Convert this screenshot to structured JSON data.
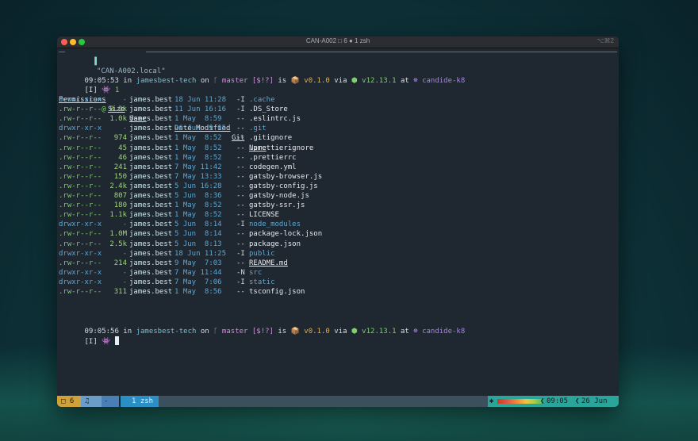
{
  "window": {
    "title": "CAN-A002 □ 6 ● 1 zsh",
    "shortcut": "⌥⌘2"
  },
  "terminal": {
    "host_header": "\"CAN-A002.local\"",
    "host_icon": "▐",
    "prompts": [
      {
        "time": "09:05:53",
        "in": " in ",
        "dir": "jamesbest-tech",
        "on": " on ",
        "branch_icon": "ᚴ",
        "branch": " master",
        "status": " [$!?]",
        "is": " is ",
        "pkg_icon": "📦",
        "pkg": " v0.1.0",
        "via": " via ",
        "node_icon": "⬢",
        "node": " v12.13.1",
        "at": " at ",
        "kube_icon": "☸",
        "kube": " candide-k8"
      },
      {
        "time": "09:05:56",
        "in": " in ",
        "dir": "jamesbest-tech",
        "on": " on ",
        "branch_icon": "ᚴ",
        "branch": " master",
        "status": " [$!?]",
        "is": " is ",
        "pkg_icon": "📦",
        "pkg": " v0.1.0",
        "via": " via ",
        "node_icon": "⬢",
        "node": " v12.13.1",
        "at": " at ",
        "kube_icon": "☸",
        "kube": " candide-k8"
      }
    ],
    "mode1": "[I] ",
    "mode1_icon": "👾",
    "mode1_count": " 1",
    "mode2": "[I] ",
    "mode2_icon": "👾",
    "headers": {
      "permissions": "Permissions",
      "size": "Size",
      "user": "User",
      "date": "Date Modified",
      "git": "Git",
      "name": "Name"
    },
    "rows": [
      {
        "perm": "drwxr-xr-x",
        "size": "-",
        "user": "james.best",
        "date": "18 Jun 11:28",
        "git": "-I",
        "name": ".cache",
        "dir": true
      },
      {
        "perm": ".rw-r--r--@",
        "size": "8.2k",
        "user": "james.best",
        "date": "11 Jun 16:16",
        "git": "-I",
        "name": ".DS_Store",
        "dir": false
      },
      {
        "perm": ".rw-r--r--",
        "size": "1.0k",
        "user": "james.best",
        "date": "1 May  8:59",
        "git": "--",
        "name": ".eslintrc.js",
        "dir": false
      },
      {
        "perm": "drwxr-xr-x",
        "size": "-",
        "user": "james.best",
        "date": "26 Jun  9:05",
        "git": "--",
        "name": ".git",
        "dir": true
      },
      {
        "perm": ".rw-r--r--",
        "size": "974",
        "user": "james.best",
        "date": "1 May  8:52",
        "git": "--",
        "name": ".gitignore",
        "dir": false
      },
      {
        "perm": ".rw-r--r--",
        "size": "45",
        "user": "james.best",
        "date": "1 May  8:52",
        "git": "--",
        "name": ".prettierignore",
        "dir": false
      },
      {
        "perm": ".rw-r--r--",
        "size": "46",
        "user": "james.best",
        "date": "1 May  8:52",
        "git": "--",
        "name": ".prettierrc",
        "dir": false
      },
      {
        "perm": ".rw-r--r--",
        "size": "241",
        "user": "james.best",
        "date": "7 May 11:42",
        "git": "--",
        "name": "codegen.yml",
        "dir": false
      },
      {
        "perm": ".rw-r--r--",
        "size": "150",
        "user": "james.best",
        "date": "7 May 13:33",
        "git": "--",
        "name": "gatsby-browser.js",
        "dir": false
      },
      {
        "perm": ".rw-r--r--",
        "size": "2.4k",
        "user": "james.best",
        "date": "5 Jun 16:28",
        "git": "--",
        "name": "gatsby-config.js",
        "dir": false
      },
      {
        "perm": ".rw-r--r--",
        "size": "807",
        "user": "james.best",
        "date": "5 Jun  8:36",
        "git": "--",
        "name": "gatsby-node.js",
        "dir": false
      },
      {
        "perm": ".rw-r--r--",
        "size": "180",
        "user": "james.best",
        "date": "1 May  8:52",
        "git": "--",
        "name": "gatsby-ssr.js",
        "dir": false
      },
      {
        "perm": ".rw-r--r--",
        "size": "1.1k",
        "user": "james.best",
        "date": "1 May  8:52",
        "git": "--",
        "name": "LICENSE",
        "dir": false
      },
      {
        "perm": "drwxr-xr-x",
        "size": "-",
        "user": "james.best",
        "date": "5 Jun  8:14",
        "git": "-I",
        "name": "node_modules",
        "dir": true
      },
      {
        "perm": ".rw-r--r--",
        "size": "1.0M",
        "user": "james.best",
        "date": "5 Jun  8:14",
        "git": "--",
        "name": "package-lock.json",
        "dir": false
      },
      {
        "perm": ".rw-r--r--",
        "size": "2.5k",
        "user": "james.best",
        "date": "5 Jun  8:13",
        "git": "--",
        "name": "package.json",
        "dir": false
      },
      {
        "perm": "drwxr-xr-x",
        "size": "-",
        "user": "james.best",
        "date": "18 Jun 11:25",
        "git": "-I",
        "name": "public",
        "dir": true
      },
      {
        "perm": ".rw-r--r--",
        "size": "214",
        "user": "james.best",
        "date": "9 May  7:03",
        "git": "--",
        "name": "README.md",
        "dir": false,
        "underline": true
      },
      {
        "perm": "drwxr-xr-x",
        "size": "-",
        "user": "james.best",
        "date": "7 May 11:44",
        "git": "-N",
        "name": "src",
        "dir": true
      },
      {
        "perm": "drwxr-xr-x",
        "size": "-",
        "user": "james.best",
        "date": "7 May  7:06",
        "git": "-I",
        "name": "static",
        "dir": true
      },
      {
        "perm": ".rw-r--r--",
        "size": "311",
        "user": "james.best",
        "date": "1 May  8:56",
        "git": "--",
        "name": "tsconfig.json",
        "dir": false
      }
    ]
  },
  "statusbar": {
    "session_icon": "□",
    "session_count": "6",
    "music_icon": "♫",
    "dash": "-",
    "window_label": "1 zsh",
    "time": "09:05",
    "date": "26 Jun",
    "sep": "❮",
    "hostname_icon": "✱",
    "colors": {
      "seg1": "#d0a139",
      "seg2": "#6a9ec8",
      "seg4": "#2a8fc4",
      "right": "#2aa59a"
    }
  }
}
